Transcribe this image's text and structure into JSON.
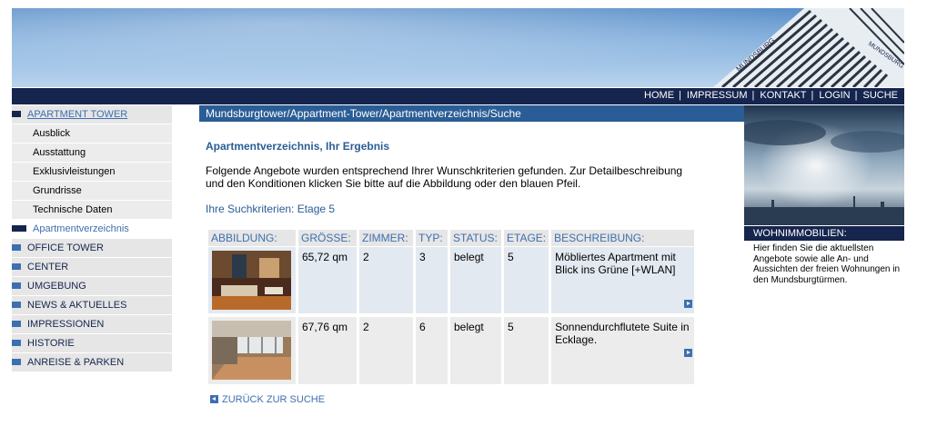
{
  "topnav": {
    "items": [
      "HOME",
      "IMPRESSUM",
      "KONTAKT",
      "LOGIN",
      "SUCHE"
    ],
    "separator": "|"
  },
  "banner": {
    "logo_text": "MUNDSBURG"
  },
  "leftnav": {
    "apartment_tower": "APARTMENT TOWER",
    "sub": [
      "Ausblick",
      "Ausstattung",
      "Exklusivleistungen",
      "Grundrisse",
      "Technische Daten"
    ],
    "current": "Apartmentverzeichnis",
    "sections": [
      "OFFICE TOWER",
      "CENTER",
      "UMGEBUNG",
      "NEWS & AKTUELLES",
      "IMPRESSIONEN",
      "HISTORIE",
      "ANREISE & PARKEN"
    ]
  },
  "breadcrumb": "Mundsburgtower/Appartment-Tower/Apartmentverzeichnis/Suche",
  "main": {
    "heading": "Apartmentverzeichnis, Ihr Ergebnis",
    "intro": "Folgende Angebote wurden entsprechend Ihrer Wunschkriterien gefunden. Zur Detailbeschreibung und den Konditionen klicken Sie bitte auf die Abbildung oder den blauen Pfeil.",
    "criteria": "Ihre Suchkriterien: Etage 5",
    "columns": [
      "ABBILDUNG:",
      "GRÖSSE:",
      "ZIMMER:",
      "TYP:",
      "STATUS:",
      "ETAGE:",
      "BESCHREIBUNG:"
    ],
    "rows": [
      {
        "size": "65,72 qm",
        "rooms": "2",
        "type": "3",
        "status": "belegt",
        "floor": "5",
        "desc": "Möbliertes Apartment mit Blick ins Grüne [+WLAN]"
      },
      {
        "size": "67,76 qm",
        "rooms": "2",
        "type": "6",
        "status": "belegt",
        "floor": "5",
        "desc": "Sonnendurchflutete Suite in Ecklage."
      }
    ],
    "back": "ZURÜCK ZUR SUCHE"
  },
  "right": {
    "label": "WOHNIMMOBILIEN:",
    "text": "Hier finden Sie die aktuellsten Angebote sowie alle An- und Aussichten der freien Wohnungen in den Mundsburgtürmen."
  },
  "colors": {
    "navy": "#16254e",
    "blue": "#2a5d95",
    "link": "#3d6fb0",
    "gray": "#e6e6e6"
  }
}
